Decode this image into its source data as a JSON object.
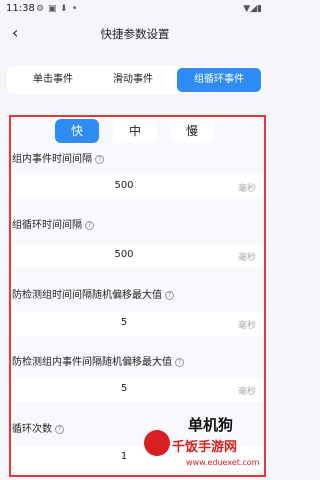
{
  "status": {
    "time": "11:38"
  },
  "header": {
    "title": "快捷参数设置"
  },
  "tabs": [
    {
      "label": "单击事件"
    },
    {
      "label": "滑动事件"
    },
    {
      "label": "组循环事件"
    }
  ],
  "speed": {
    "fast": "快",
    "mid": "中",
    "slow": "慢"
  },
  "fields": [
    {
      "label": "组内事件时间间隔",
      "value": "500",
      "unit": "毫秒"
    },
    {
      "label": "组循环时间间隔",
      "value": "500",
      "unit": "毫秒"
    },
    {
      "label": "防检测组时间间隔随机偏移最大值",
      "value": "5",
      "unit": "毫秒"
    },
    {
      "label": "防检测组内事件间隔随机偏移最大值",
      "value": "5",
      "unit": "毫秒"
    },
    {
      "label": "循环次数",
      "value": "1",
      "unit": ""
    }
  ],
  "watermark": {
    "line1": "单机狗",
    "line2": "千饭手游网",
    "line3": "www.eduexet.com"
  },
  "colors": {
    "accent": "#2f8cf5",
    "highlight_border": "#e53838"
  }
}
